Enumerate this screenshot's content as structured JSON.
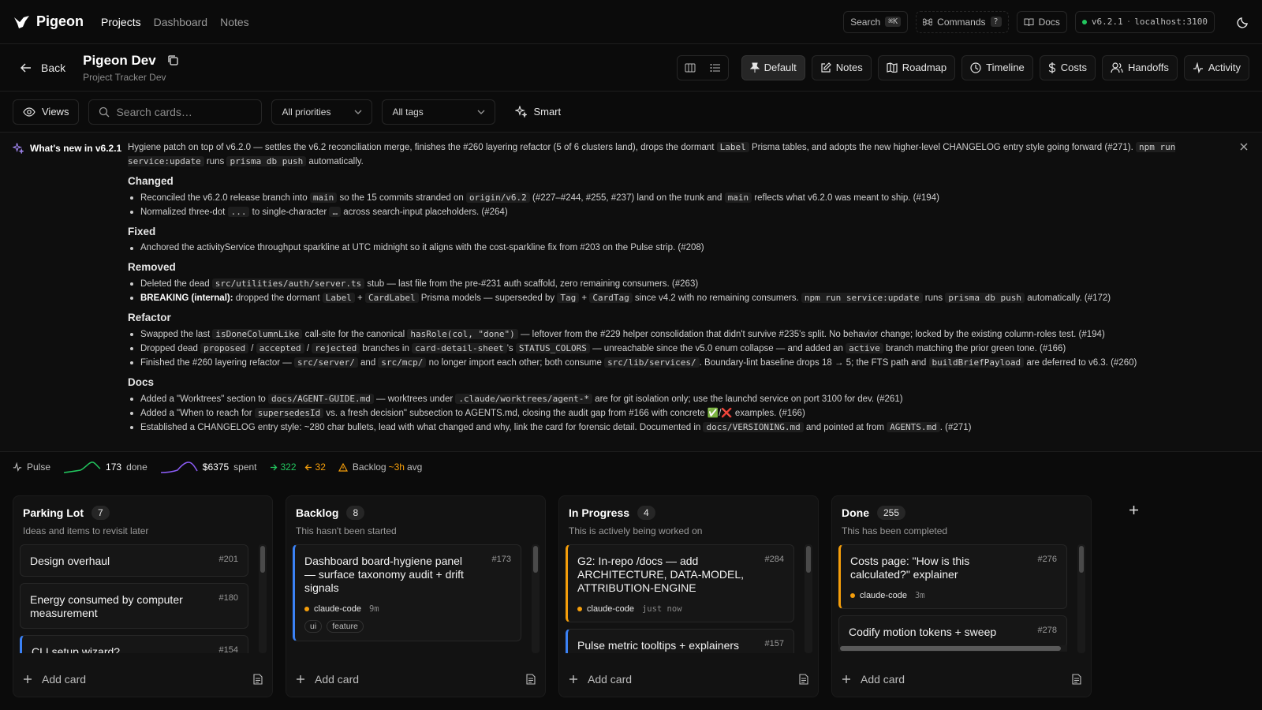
{
  "nav": {
    "brand": "Pigeon",
    "links": [
      "Projects",
      "Dashboard",
      "Notes"
    ],
    "search": "Search",
    "search_kbd": "⌘K",
    "commands": "Commands",
    "commands_kbd": "?",
    "docs": "Docs",
    "version": "v6.2.1",
    "separator": "·",
    "host": "localhost:3100"
  },
  "project": {
    "back": "Back",
    "title": "Pigeon Dev",
    "subtitle": "Project Tracker Dev",
    "views": [
      "Default",
      "Notes",
      "Roadmap",
      "Timeline",
      "Costs",
      "Handoffs",
      "Activity"
    ]
  },
  "filters": {
    "views": "Views",
    "search_placeholder": "Search cards…",
    "priority": "All priorities",
    "tags": "All tags",
    "smart": "Smart"
  },
  "whatsnew": {
    "label": "What's new in v6.2.1",
    "intro": [
      {
        "t": "Hygiene patch on top of v6.2.0 — settles the v6.2 reconciliation merge, finishes the #260 layering refactor (5 of 6 clusters land), drops the dormant "
      },
      {
        "c": "Label"
      },
      {
        "t": " Prisma tables, and adopts the new higher-level CHANGELOG entry style going forward (#271). "
      },
      {
        "c": "npm run service:update"
      },
      {
        "t": " runs "
      },
      {
        "c": "prisma db push"
      },
      {
        "t": " automatically."
      }
    ],
    "sections": [
      {
        "title": "Changed",
        "items": [
          [
            {
              "t": "Reconciled the v6.2.0 release branch into "
            },
            {
              "c": "main"
            },
            {
              "t": " so the 15 commits stranded on "
            },
            {
              "c": "origin/v6.2"
            },
            {
              "t": " (#227–#244, #255, #237) land on the trunk and "
            },
            {
              "c": "main"
            },
            {
              "t": " reflects what v6.2.0 was meant to ship. (#194)"
            }
          ],
          [
            {
              "t": "Normalized three-dot "
            },
            {
              "c": "..."
            },
            {
              "t": " to single-character "
            },
            {
              "c": "…"
            },
            {
              "t": " across search-input placeholders. (#264)"
            }
          ]
        ]
      },
      {
        "title": "Fixed",
        "items": [
          [
            {
              "t": "Anchored the activityService throughput sparkline at UTC midnight so it aligns with the cost-sparkline fix from #203 on the Pulse strip. (#208)"
            }
          ]
        ]
      },
      {
        "title": "Removed",
        "items": [
          [
            {
              "t": "Deleted the dead "
            },
            {
              "c": "src/utilities/auth/server.ts"
            },
            {
              "t": " stub — last file from the pre-#231 auth scaffold, zero remaining consumers. (#263)"
            }
          ],
          [
            {
              "b": "BREAKING (internal):"
            },
            {
              "t": " dropped the dormant "
            },
            {
              "c": "Label"
            },
            {
              "t": " + "
            },
            {
              "c": "CardLabel"
            },
            {
              "t": " Prisma models — superseded by "
            },
            {
              "c": "Tag"
            },
            {
              "t": " + "
            },
            {
              "c": "CardTag"
            },
            {
              "t": " since v4.2 with no remaining consumers. "
            },
            {
              "c": "npm run service:update"
            },
            {
              "t": " runs "
            },
            {
              "c": "prisma db push"
            },
            {
              "t": " automatically. (#172)"
            }
          ]
        ]
      },
      {
        "title": "Refactor",
        "items": [
          [
            {
              "t": "Swapped the last "
            },
            {
              "c": "isDoneColumnLike"
            },
            {
              "t": " call-site for the canonical "
            },
            {
              "c": "hasRole(col, \"done\")"
            },
            {
              "t": " — leftover from the #229 helper consolidation that didn't survive #235's split. No behavior change; locked by the existing column-roles test. (#194)"
            }
          ],
          [
            {
              "t": "Dropped dead "
            },
            {
              "c": "proposed"
            },
            {
              "t": " / "
            },
            {
              "c": "accepted"
            },
            {
              "t": " / "
            },
            {
              "c": "rejected"
            },
            {
              "t": " branches in "
            },
            {
              "c": "card-detail-sheet"
            },
            {
              "t": "'s "
            },
            {
              "c": "STATUS_COLORS"
            },
            {
              "t": " — unreachable since the v5.0 enum collapse — and added an "
            },
            {
              "c": "active"
            },
            {
              "t": " branch matching the prior green tone. (#166)"
            }
          ],
          [
            {
              "t": "Finished the #260 layering refactor — "
            },
            {
              "c": "src/server/"
            },
            {
              "t": " and "
            },
            {
              "c": "src/mcp/"
            },
            {
              "t": " no longer import each other; both consume "
            },
            {
              "c": "src/lib/services/"
            },
            {
              "t": ". Boundary-lint baseline drops 18 → 5; the FTS path and "
            },
            {
              "c": "buildBriefPayload"
            },
            {
              "t": " are deferred to v6.3. (#260)"
            }
          ]
        ]
      },
      {
        "title": "Docs",
        "items": [
          [
            {
              "t": "Added a \"Worktrees\" section to "
            },
            {
              "c": "docs/AGENT-GUIDE.md"
            },
            {
              "t": " — worktrees under "
            },
            {
              "c": ".claude/worktrees/agent-*"
            },
            {
              "t": " are for git isolation only; use the launchd service on port 3100 for dev. (#261)"
            }
          ],
          [
            {
              "t": "Added a \"When to reach for "
            },
            {
              "c": "supersedesId"
            },
            {
              "t": " vs. a fresh decision\" subsection to AGENTS.md, closing the audit gap from #166 with concrete ✅/❌ examples. (#166)"
            }
          ],
          [
            {
              "t": "Established a CHANGELOG entry style: ~280 char bullets, lead with what changed and why, link the card for forensic detail. Documented in "
            },
            {
              "c": "docs/VERSIONING.md"
            },
            {
              "t": " and pointed at from "
            },
            {
              "c": "AGENTS.md"
            },
            {
              "t": ". (#271)"
            }
          ]
        ]
      }
    ]
  },
  "pulse": {
    "label": "Pulse",
    "done_count": "173",
    "done_label": "done",
    "spent": "$6375",
    "spent_label": "spent",
    "up": "322",
    "down": "32",
    "backlog_label": "Backlog",
    "backlog_avg": "~3h",
    "backlog_avg_label": "avg",
    "up_color": "#22c55e",
    "down_color": "#f59e0b"
  },
  "board": {
    "add_label": "Add card",
    "columns": [
      {
        "name": "Parking Lot",
        "count": "7",
        "desc": "Ideas and items to revisit later",
        "cards": [
          {
            "title": "Design overhaul",
            "num": "#201"
          },
          {
            "title": "Energy consumed by computer measurement",
            "num": "#180"
          },
          {
            "title": "CLI setup wizard?",
            "num": "#154",
            "accent": "blue"
          }
        ]
      },
      {
        "name": "Backlog",
        "count": "8",
        "desc": "This hasn't been started",
        "cards": [
          {
            "title": "Dashboard board-hygiene panel — surface taxonomy audit + drift signals",
            "num": "#173",
            "accent": "blue",
            "agent": "claude-code",
            "time": "9m",
            "tags": [
              "ui",
              "feature"
            ]
          }
        ]
      },
      {
        "name": "In Progress",
        "count": "4",
        "desc": "This is actively being worked on",
        "cards": [
          {
            "title": "G2: In-repo /docs — add ARCHITECTURE, DATA-MODEL, ATTRIBUTION-ENGINE",
            "num": "#284",
            "accent": "amber",
            "agent": "claude-code",
            "time": "just now"
          },
          {
            "title": "Pulse metric tooltips + explainers",
            "num": "#157",
            "accent": "blue"
          }
        ]
      },
      {
        "name": "Done",
        "count": "255",
        "desc": "This has been completed",
        "cards": [
          {
            "title": "Costs page: \"How is this calculated?\" explainer",
            "num": "#276",
            "accent": "amber",
            "agent": "claude-code",
            "time": "3m"
          },
          {
            "title": "Codify motion tokens + sweep",
            "num": "#278"
          }
        ]
      }
    ]
  }
}
